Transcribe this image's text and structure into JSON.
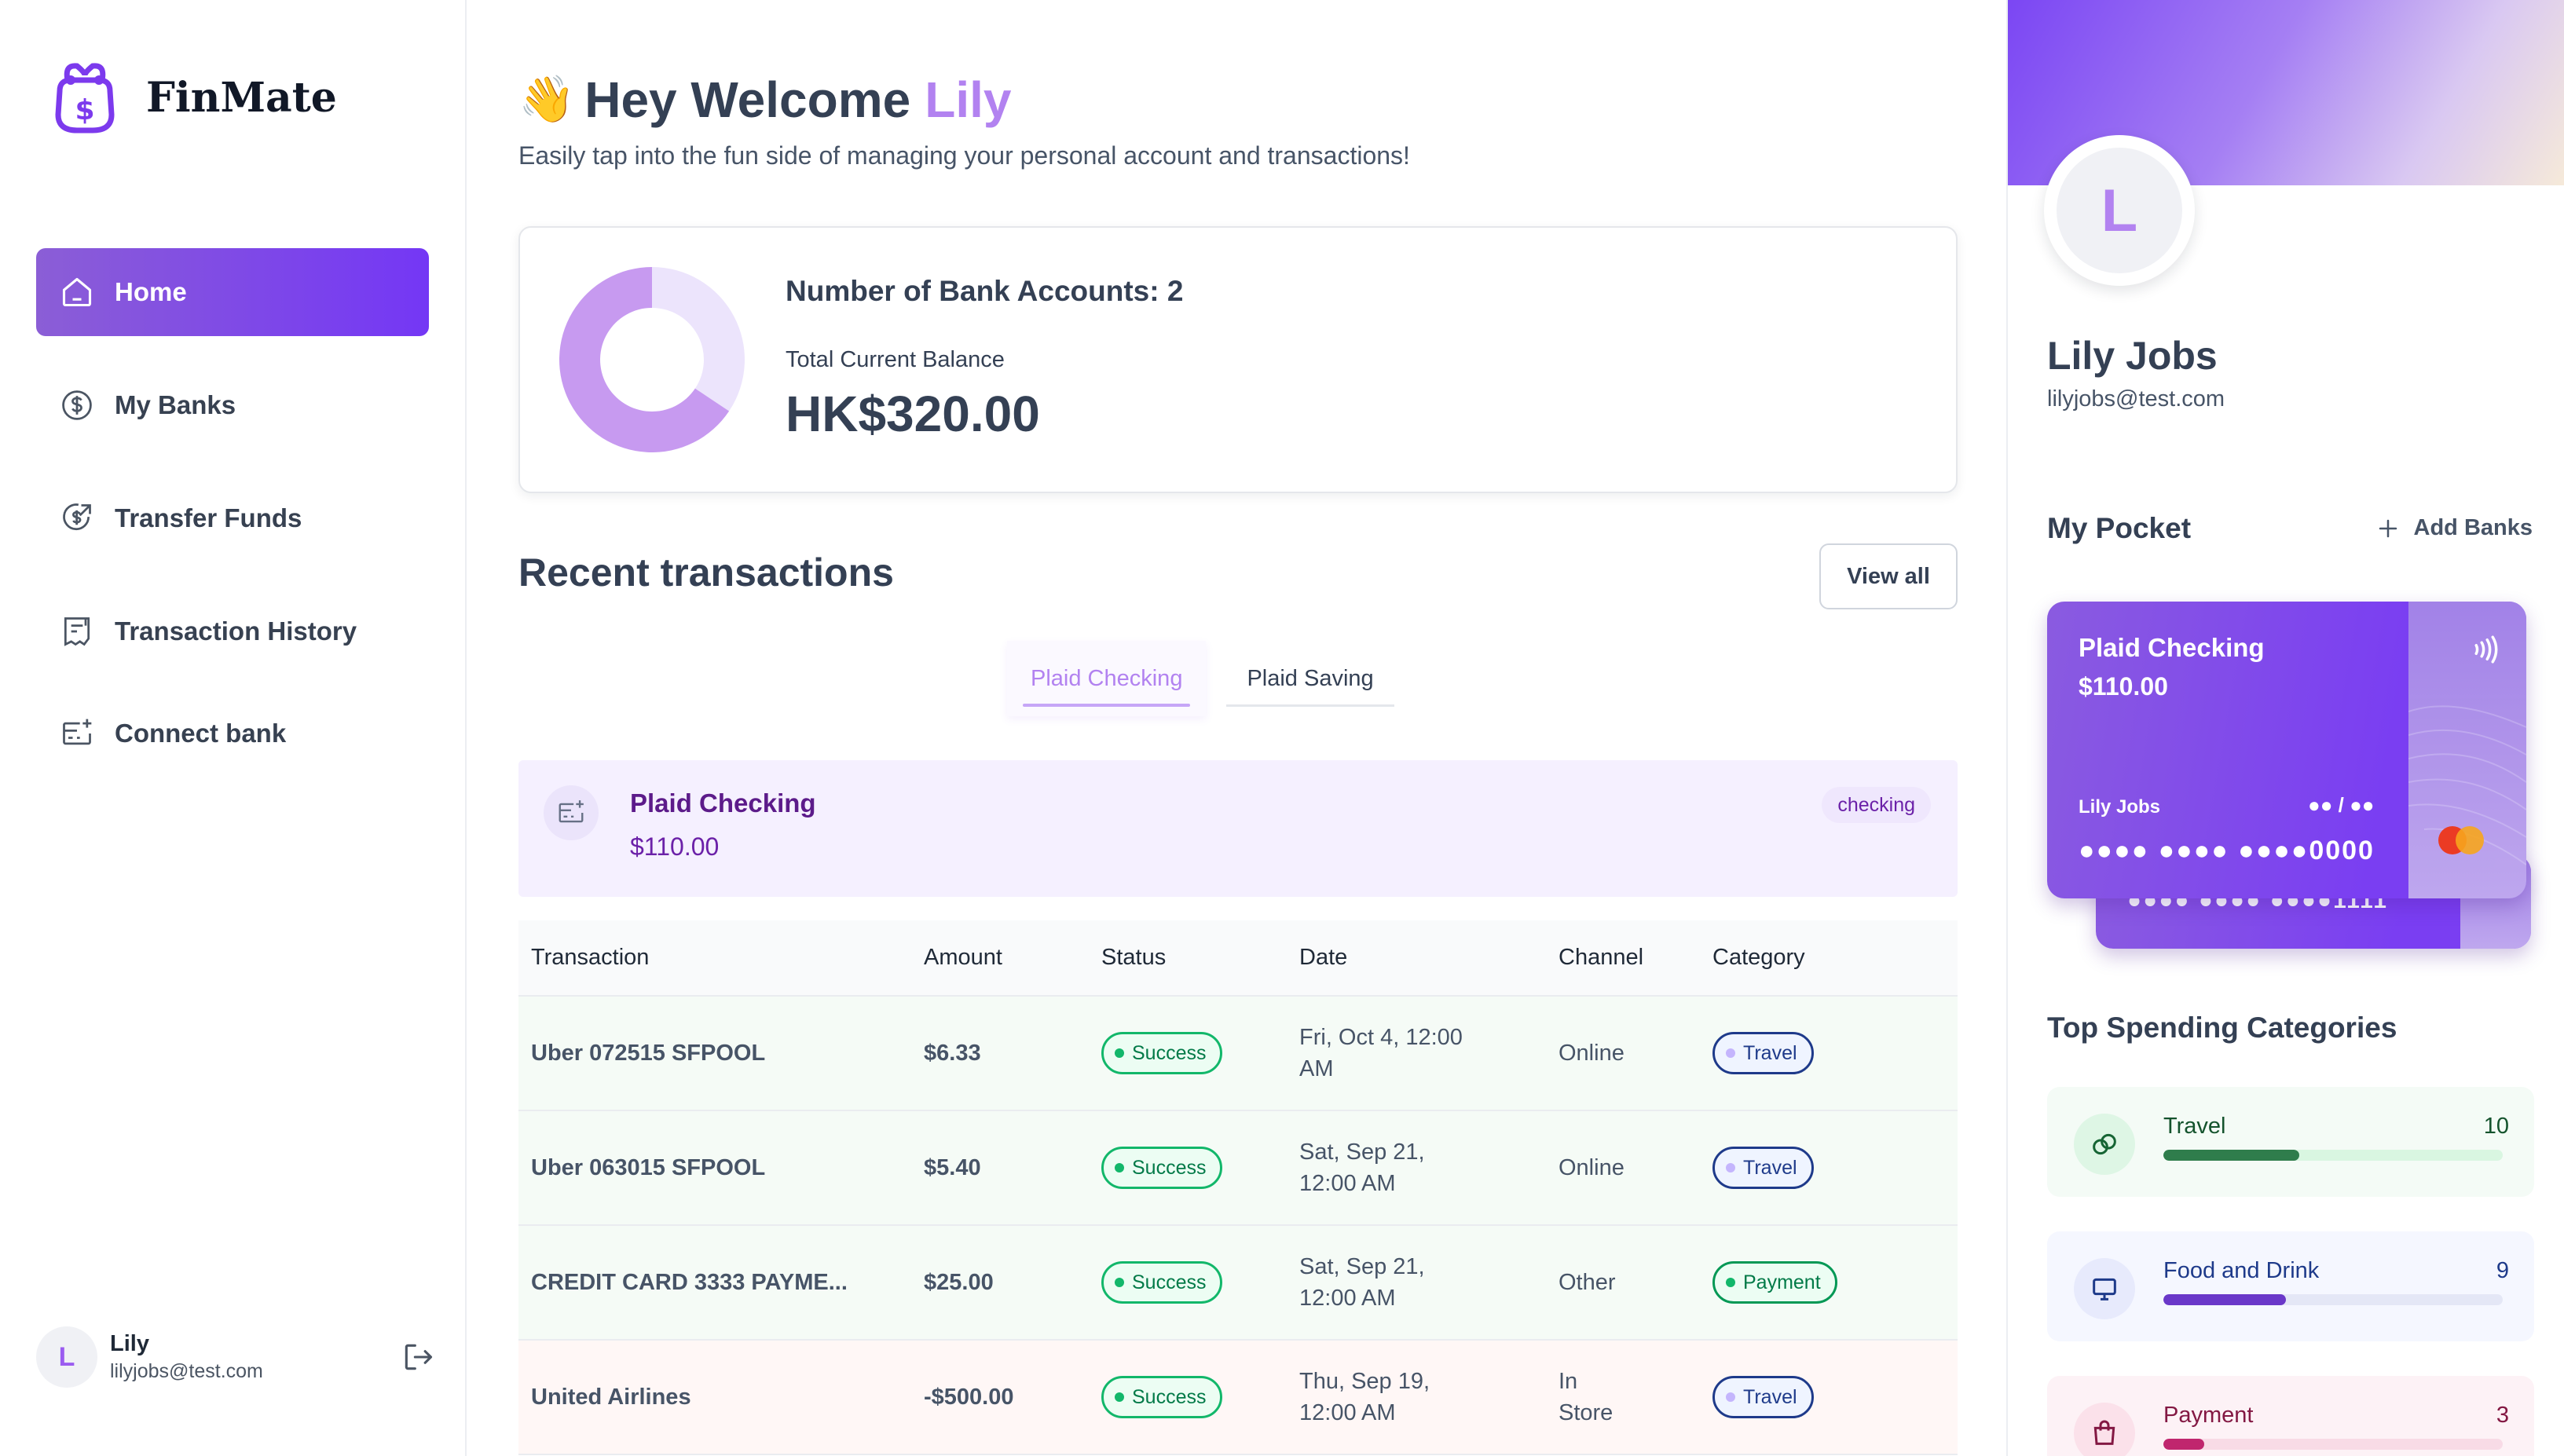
{
  "app": {
    "name": "FinMate"
  },
  "nav": [
    {
      "label": "Home",
      "icon": "home-icon",
      "active": true
    },
    {
      "label": "My Banks",
      "icon": "dollar-circle-icon"
    },
    {
      "label": "Transfer Funds",
      "icon": "transfer-icon"
    },
    {
      "label": "Transaction History",
      "icon": "receipt-icon"
    },
    {
      "label": "Connect bank",
      "icon": "card-plus-icon"
    }
  ],
  "sidebar_footer": {
    "initial": "L",
    "name": "Lily",
    "email": "lilyjobs@test.com"
  },
  "header": {
    "emoji": "👋",
    "greeting": "Hey Welcome",
    "name": "Lily",
    "subtitle": "Easily tap into the fun side of managing your personal account and transactions!"
  },
  "balance": {
    "accounts_label": "Number of Bank Accounts: 2",
    "total_label": "Total Current Balance",
    "total": "HK$320.00",
    "chart_data": {
      "type": "pie",
      "categories": [
        "Plaid Checking",
        "Plaid Saving"
      ],
      "values": [
        110,
        210
      ],
      "colors": [
        "#ece4fc",
        "#c79af0"
      ]
    }
  },
  "recent": {
    "title": "Recent transactions",
    "view_all": "View all",
    "tabs": [
      "Plaid Checking",
      "Plaid Saving"
    ],
    "account": {
      "name": "Plaid Checking",
      "balance": "$110.00",
      "type": "checking"
    },
    "columns": [
      "Transaction",
      "Amount",
      "Status",
      "Date",
      "Channel",
      "Category"
    ],
    "rows": [
      {
        "name": "Uber 072515 SFPOOL",
        "amount": "$6.33",
        "status": "Success",
        "date": "Fri, Oct 4, 12:00 AM",
        "channel": "Online",
        "category": "Travel",
        "type": "pos"
      },
      {
        "name": "Uber 063015 SFPOOL",
        "amount": "$5.40",
        "status": "Success",
        "date": "Sat, Sep 21, 12:00 AM",
        "channel": "Online",
        "category": "Travel",
        "type": "pos"
      },
      {
        "name": "CREDIT CARD 3333 PAYME...",
        "amount": "$25.00",
        "status": "Success",
        "date": "Sat, Sep 21, 12:00 AM",
        "channel": "Other",
        "category": "Payment",
        "type": "pos"
      },
      {
        "name": "United Airlines",
        "amount": "-$500.00",
        "status": "Success",
        "date": "Thu, Sep 19, 12:00 AM",
        "channel": "In Store",
        "category": "Travel",
        "type": "neg"
      }
    ]
  },
  "profile": {
    "initial": "L",
    "name": "Lily Jobs",
    "email": "lilyjobs@test.com"
  },
  "pocket": {
    "title": "My Pocket",
    "add_label": "Add Banks",
    "card_front": {
      "name": "Plaid Checking",
      "amount": "$110.00",
      "holder": "Lily Jobs",
      "expiry": "●● / ●●",
      "number": "●●●● ●●●● ●●●●0000"
    },
    "card_back": {
      "number": "●●●● ●●●● ●●●●1111"
    }
  },
  "spending": {
    "title": "Top Spending Categories",
    "items": [
      {
        "label": "Travel",
        "count": "10",
        "fraction": 0.4,
        "bg": "#f4fbf6",
        "icon_bg": "#def6e5",
        "icon": "link-icon",
        "text": "#14532d",
        "track": "#d9f6e1",
        "fill": "#2f7d4c"
      },
      {
        "label": "Food and Drink",
        "count": "9",
        "fraction": 0.36,
        "bg": "#f5f7ff",
        "icon_bg": "#e7eafc",
        "icon": "monitor-icon",
        "text": "#1e3a8a",
        "track": "#e4e7f6",
        "fill": "#6a38c9"
      },
      {
        "label": "Payment",
        "count": "3",
        "fraction": 0.12,
        "bg": "#fdf2f6",
        "icon_bg": "#fbe1ea",
        "icon": "bag-icon",
        "text": "#831843",
        "track": "#f8dbe6",
        "fill": "#c0266e"
      }
    ]
  }
}
